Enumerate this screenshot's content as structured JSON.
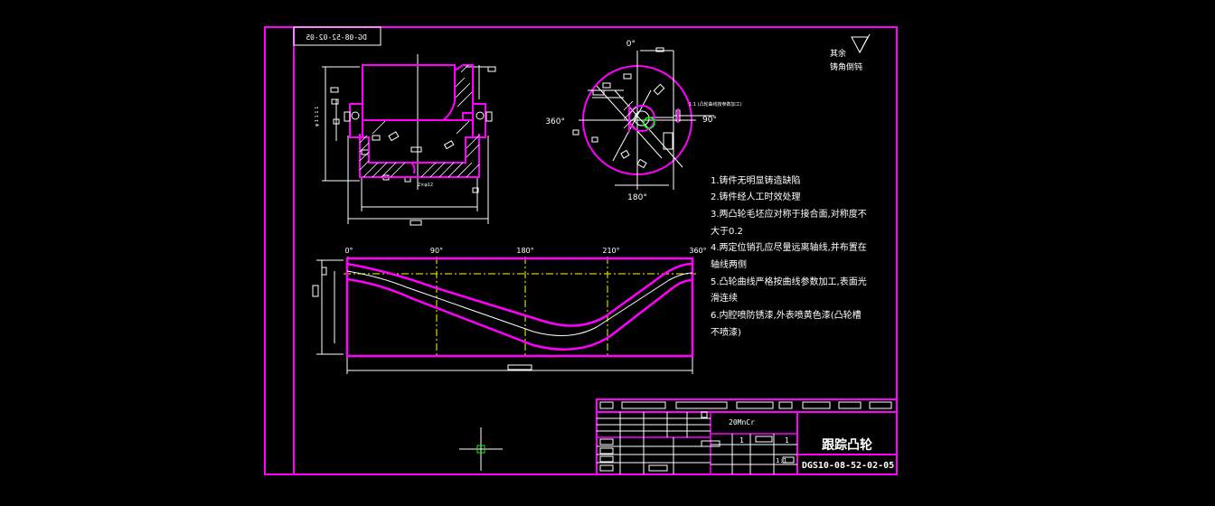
{
  "drawing": {
    "colors": {
      "border": "#ff00ff",
      "profile": "#ff00ff",
      "lines": "#ffffff",
      "centerline": "#ffff00",
      "section": "#00ff00",
      "background": "#000000"
    },
    "mirror_code": "DG-08-52-02-05",
    "surface_note": [
      "其余",
      "铸角倒钝"
    ],
    "angle_labels": {
      "top": "0°",
      "left": "360°",
      "right": "90°",
      "bottom": "180°"
    },
    "leader_note": "1:1 (凸轮曲线按参数加工)",
    "dev_labels": [
      "0°",
      "90°",
      "180°",
      "210°",
      "360°"
    ],
    "notes": [
      "1.铸件无明显铸造缺陷",
      "2.铸件经人工时效处理",
      "3.两凸轮毛坯应对称于接合面,对称度不",
      "大于0.2",
      "4.两定位销孔应尽量远离轴线,并布置在",
      "轴线两侧",
      "5.凸轮曲线严格按曲线参数加工,表面光",
      "滑连续",
      "6.内腔喷防锈漆,外表喷黄色漆(凸轮槽",
      "不喷漆)"
    ],
    "title_block": {
      "material": "20MnCr",
      "part_name": "跟踪凸轮",
      "drawing_number": "DGS10-08-52-02-05",
      "qty_1": "1",
      "qty_2": "1",
      "scale": "1:1"
    }
  }
}
